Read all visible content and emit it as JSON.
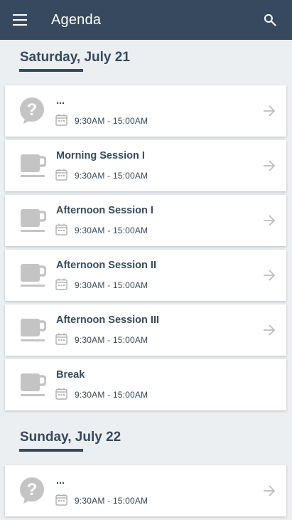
{
  "header": {
    "title": "Agenda",
    "menu_icon": "menu-icon",
    "search_icon": "search-icon"
  },
  "colors": {
    "appbar": "#37495e",
    "background": "#eceff1",
    "text": "#37495e",
    "icon_gray": "#c4c4c4"
  },
  "days": [
    {
      "label": "Saturday, July 21",
      "sessions": [
        {
          "name": "...",
          "time": "9:30AM - 15:00AM",
          "icon": "question-icon",
          "has_arrow": true
        },
        {
          "name": "Morning Session I",
          "time": "9:30AM - 15:00AM",
          "icon": "coffee-icon",
          "has_arrow": true
        },
        {
          "name": "Afternoon Session I",
          "time": "9:30AM - 15:00AM",
          "icon": "coffee-icon",
          "has_arrow": true
        },
        {
          "name": "Afternoon Session II",
          "time": "9:30AM - 15:00AM",
          "icon": "coffee-icon",
          "has_arrow": true
        },
        {
          "name": "Afternoon Session III",
          "time": "9:30AM - 15:00AM",
          "icon": "coffee-icon",
          "has_arrow": true
        },
        {
          "name": "Break",
          "time": "9:30AM - 15:00AM",
          "icon": "coffee-icon",
          "has_arrow": false
        }
      ]
    },
    {
      "label": "Sunday, July 22",
      "sessions": [
        {
          "name": "...",
          "time": "9:30AM - 15:00AM",
          "icon": "question-icon",
          "has_arrow": true
        }
      ]
    }
  ]
}
